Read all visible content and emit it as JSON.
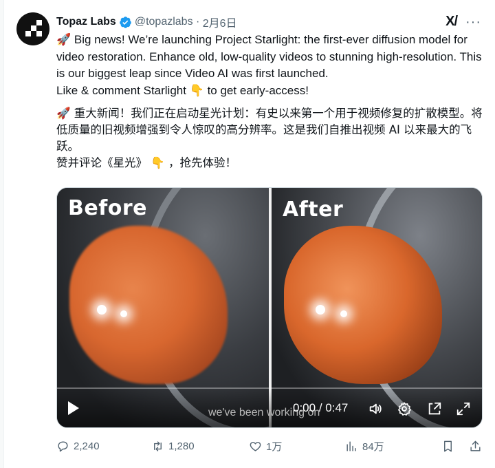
{
  "tweet": {
    "author_name": "Topaz Labs",
    "handle": "@topazlabs",
    "separator": " · ",
    "date": "2月6日",
    "grok_label": "X/",
    "more_label": "···",
    "paragraphs_en": [
      "🚀 Big news! We’re launching Project Starlight: the first-ever diffusion model for video restoration. Enhance old, low-quality videos to stunning high-resolution. This is our biggest leap since Video AI was first launched.",
      "Like & comment Starlight 👇 to get early-access!"
    ],
    "paragraphs_zh": [
      "🚀 重大新闻！我们正在启动星光计划：有史以来第一个用于视频修复的扩散模型。将低质量的旧视频增强到令人惊叹的高分辨率。这是我们自推出视频 AI 以来最大的飞跃。",
      "赞并评论《星光》 👇 ，抢先体验！"
    ]
  },
  "media": {
    "before_label": "Before",
    "after_label": "After",
    "caption": "we've been working on",
    "time_current": "0:00",
    "time_separator": " / ",
    "time_total": "0:47",
    "progress": 0
  },
  "actions": {
    "replies": "2,240",
    "reposts": "1,280",
    "likes": "1万",
    "views": "84万"
  },
  "colors": {
    "text_primary": "#0f1419",
    "text_secondary": "#536471",
    "verified": "#1d9bf0"
  }
}
